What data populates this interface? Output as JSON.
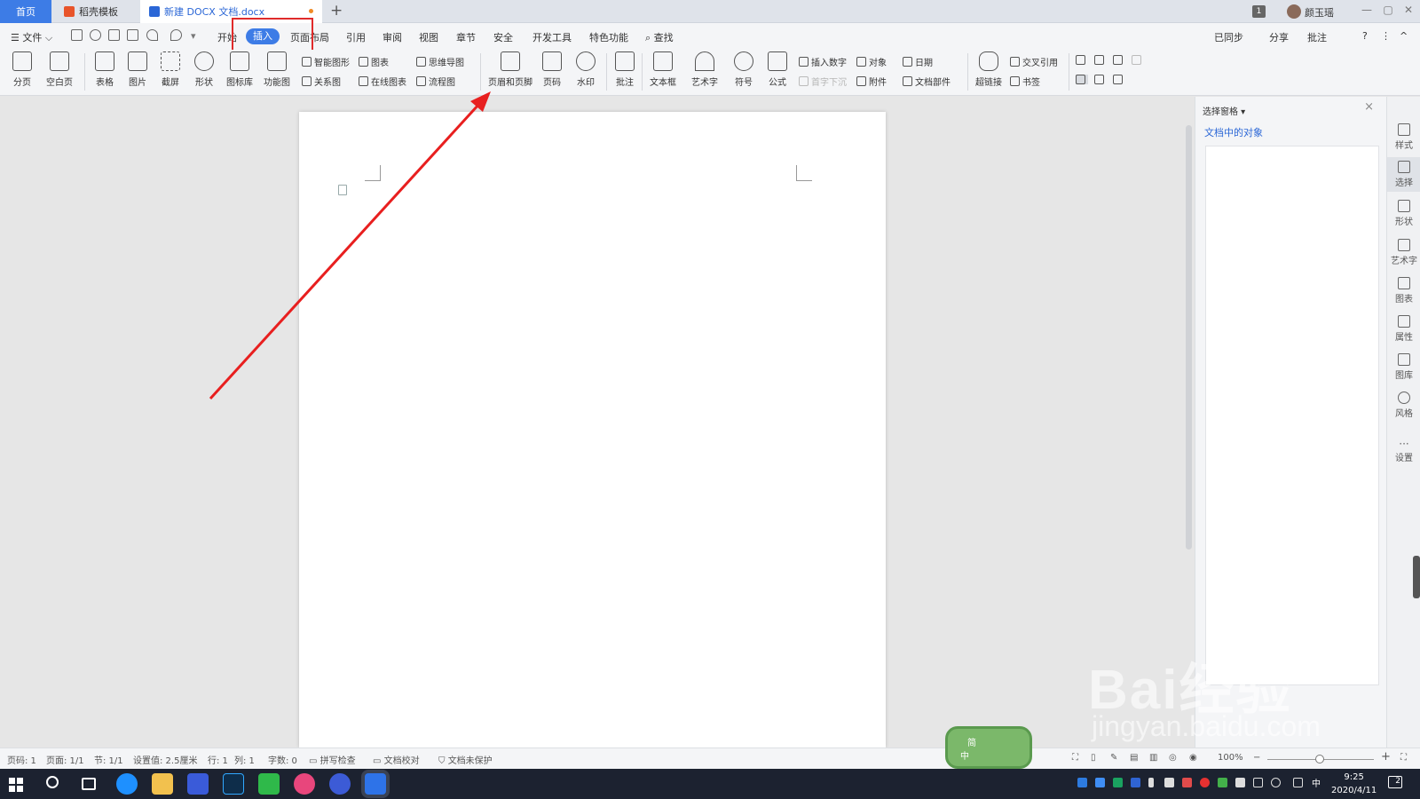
{
  "titlebar": {
    "tabs": [
      {
        "label": "首页",
        "color": "#3d7ce6"
      },
      {
        "label": "稻壳模板",
        "color": "#e8542a"
      },
      {
        "label": "新建 DOCX 文档.docx",
        "color": "#2a66d6"
      }
    ],
    "new_tab": "+",
    "badge": "1",
    "user": "颜玉瑶"
  },
  "menu": {
    "file": "☰ 文件 ⌵",
    "tabs": [
      "开始",
      "插入",
      "页面布局",
      "引用",
      "审阅",
      "视图",
      "章节",
      "安全",
      "开发工具",
      "特色功能"
    ],
    "search": "查找",
    "active_tab": "插入",
    "right": [
      "已同步",
      "分享",
      "批注",
      "?",
      "⋮",
      "^"
    ]
  },
  "ribbon": {
    "big": [
      {
        "label": "分页",
        "icon": "page-break-icon"
      },
      {
        "label": "空白页",
        "icon": "blank-page-icon"
      },
      {
        "label": "表格",
        "icon": "table-icon"
      },
      {
        "label": "图片",
        "icon": "picture-icon"
      },
      {
        "label": "截屏",
        "icon": "screenshot-icon"
      },
      {
        "label": "形状",
        "icon": "shape-icon"
      },
      {
        "label": "图标库",
        "icon": "icon-library-icon"
      },
      {
        "label": "功能图",
        "icon": "function-chart-icon"
      },
      {
        "label": "页眉和页脚",
        "icon": "header-footer-icon"
      },
      {
        "label": "页码",
        "icon": "page-number-icon"
      },
      {
        "label": "水印",
        "icon": "watermark-icon"
      },
      {
        "label": "批注",
        "icon": "comment-icon"
      },
      {
        "label": "文本框",
        "icon": "textbox-icon"
      },
      {
        "label": "艺术字",
        "icon": "wordart-icon"
      },
      {
        "label": "符号",
        "icon": "symbol-icon"
      },
      {
        "label": "公式",
        "icon": "formula-icon"
      },
      {
        "label": "超链接",
        "icon": "hyperlink-icon"
      }
    ],
    "small": [
      {
        "label": "智能图形"
      },
      {
        "label": "图表"
      },
      {
        "label": "思维导图"
      },
      {
        "label": "关系图"
      },
      {
        "label": "在线图表"
      },
      {
        "label": "流程图"
      },
      {
        "label": "插入数字"
      },
      {
        "label": "对象"
      },
      {
        "label": "日期"
      },
      {
        "label": "首字下沉"
      },
      {
        "label": "附件"
      },
      {
        "label": "文档部件"
      },
      {
        "label": "交叉引用"
      },
      {
        "label": "书签"
      }
    ]
  },
  "panel": {
    "title": "选择窗格",
    "subtitle": "文档中的对象",
    "close": "×"
  },
  "sidebar": [
    "样式",
    "选择",
    "形状",
    "艺术字",
    "图表",
    "属性",
    "图库",
    "风格",
    "设置"
  ],
  "status": {
    "page": "页码: 1",
    "pages": "页面: 1/1",
    "section": "节: 1/1",
    "setting": "设置值: 2.5厘米",
    "row": "行: 1",
    "col": "列: 1",
    "words": "字数: 0",
    "spell": "拼写检查",
    "proof": "文档校对",
    "protect": "文档未保护",
    "zoom": "100%"
  },
  "ime": {
    "mode": "简",
    "lang": "中"
  },
  "clock": {
    "time": "9:25",
    "date": "2020/4/11"
  },
  "notifications": "2",
  "watermark": {
    "line1": "Bai",
    "line2": "经验",
    "url": "jingyan.baidu.com"
  },
  "colors": {
    "accent": "#3d7ce6",
    "highlight": "#e02b2b",
    "arrow": "#e81f1f"
  }
}
